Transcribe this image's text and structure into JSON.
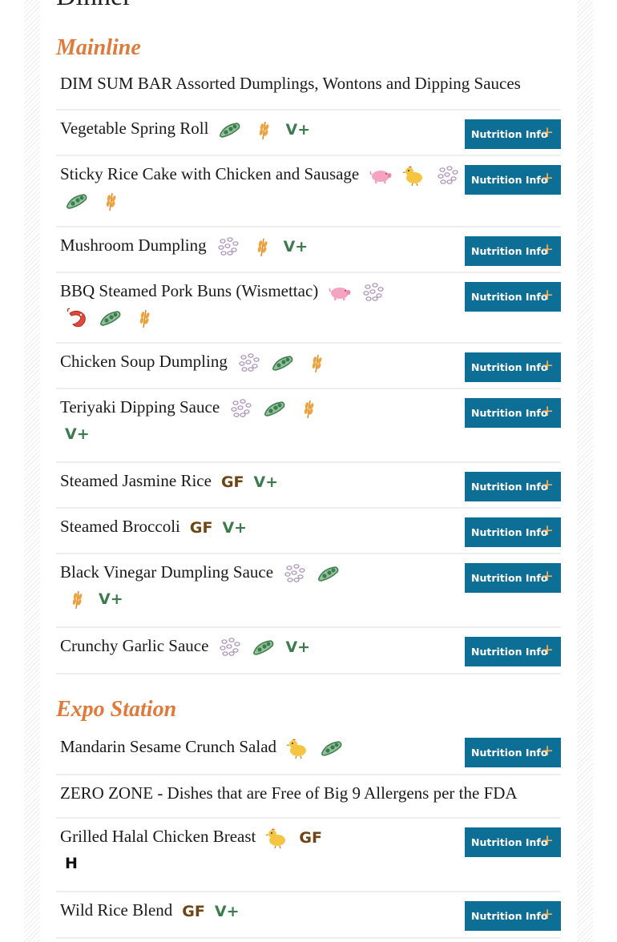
{
  "meal_title": "Dinner",
  "nutrition_button_label": "Nutrition Info",
  "nutrition_button_symbol": "+",
  "icon_text": {
    "gf": "GF",
    "vp": "V+",
    "h": "H"
  },
  "colors": {
    "accent": "#e07a3a",
    "button": "#0d6e96",
    "gluten_free": "#6e4517",
    "vegan": "#3d7b4f"
  },
  "sections": [
    {
      "title": "Mainline",
      "items": [
        {
          "name": "DIM SUM BAR Assorted Dumplings, Wontons and Dipping Sauces",
          "icons": [],
          "has_button": false
        },
        {
          "name": "Vegetable Spring Roll",
          "icons": [
            "soy-icon",
            "wheat-icon",
            "vegan-icon"
          ],
          "has_button": true
        },
        {
          "name": "Sticky Rice Cake with Chicken and Sausage",
          "icons": [
            "pork-icon",
            "chicken-icon",
            "sesame-icon",
            "shellfish-icon",
            "soy-icon",
            "wheat-icon"
          ],
          "has_button": true
        },
        {
          "name": "Mushroom Dumpling",
          "icons": [
            "sesame-icon",
            "wheat-icon",
            "vegan-icon"
          ],
          "has_button": true
        },
        {
          "name": "BBQ Steamed Pork Buns (Wismettac)",
          "icons": [
            "pork-icon",
            "sesame-icon",
            "shellfish-icon",
            "soy-icon",
            "wheat-icon"
          ],
          "has_button": true
        },
        {
          "name": "Chicken Soup Dumpling",
          "icons": [
            "sesame-icon",
            "soy-icon",
            "wheat-icon"
          ],
          "has_button": true
        },
        {
          "name": "Teriyaki Dipping Sauce",
          "icons": [
            "sesame-icon",
            "soy-icon",
            "wheat-icon",
            "vegan-icon"
          ],
          "has_button": true
        },
        {
          "name": "Steamed Jasmine Rice",
          "icons": [
            "gluten-free-icon",
            "vegan-icon"
          ],
          "has_button": true
        },
        {
          "name": "Steamed Broccoli",
          "icons": [
            "gluten-free-icon",
            "vegan-icon"
          ],
          "has_button": true
        },
        {
          "name": "Black Vinegar Dumpling Sauce",
          "icons": [
            "sesame-icon",
            "soy-icon",
            "wheat-icon",
            "vegan-icon"
          ],
          "has_button": true
        },
        {
          "name": "Crunchy Garlic Sauce",
          "icons": [
            "sesame-icon",
            "soy-icon",
            "vegan-icon"
          ],
          "has_button": true
        }
      ]
    },
    {
      "title": "Expo Station",
      "items": [
        {
          "name": "Mandarin Sesame Crunch Salad",
          "icons": [
            "chicken-icon",
            "soy-icon"
          ],
          "has_button": true
        },
        {
          "name": "ZERO ZONE - Dishes that are Free of Big 9 Allergens per the FDA",
          "icons": [],
          "has_button": false
        },
        {
          "name": "Grilled Halal Chicken Breast",
          "icons": [
            "chicken-icon",
            "gluten-free-icon",
            "halal-icon"
          ],
          "has_button": true
        },
        {
          "name": "Wild Rice Blend",
          "icons": [
            "gluten-free-icon",
            "vegan-icon"
          ],
          "has_button": true
        }
      ]
    }
  ]
}
